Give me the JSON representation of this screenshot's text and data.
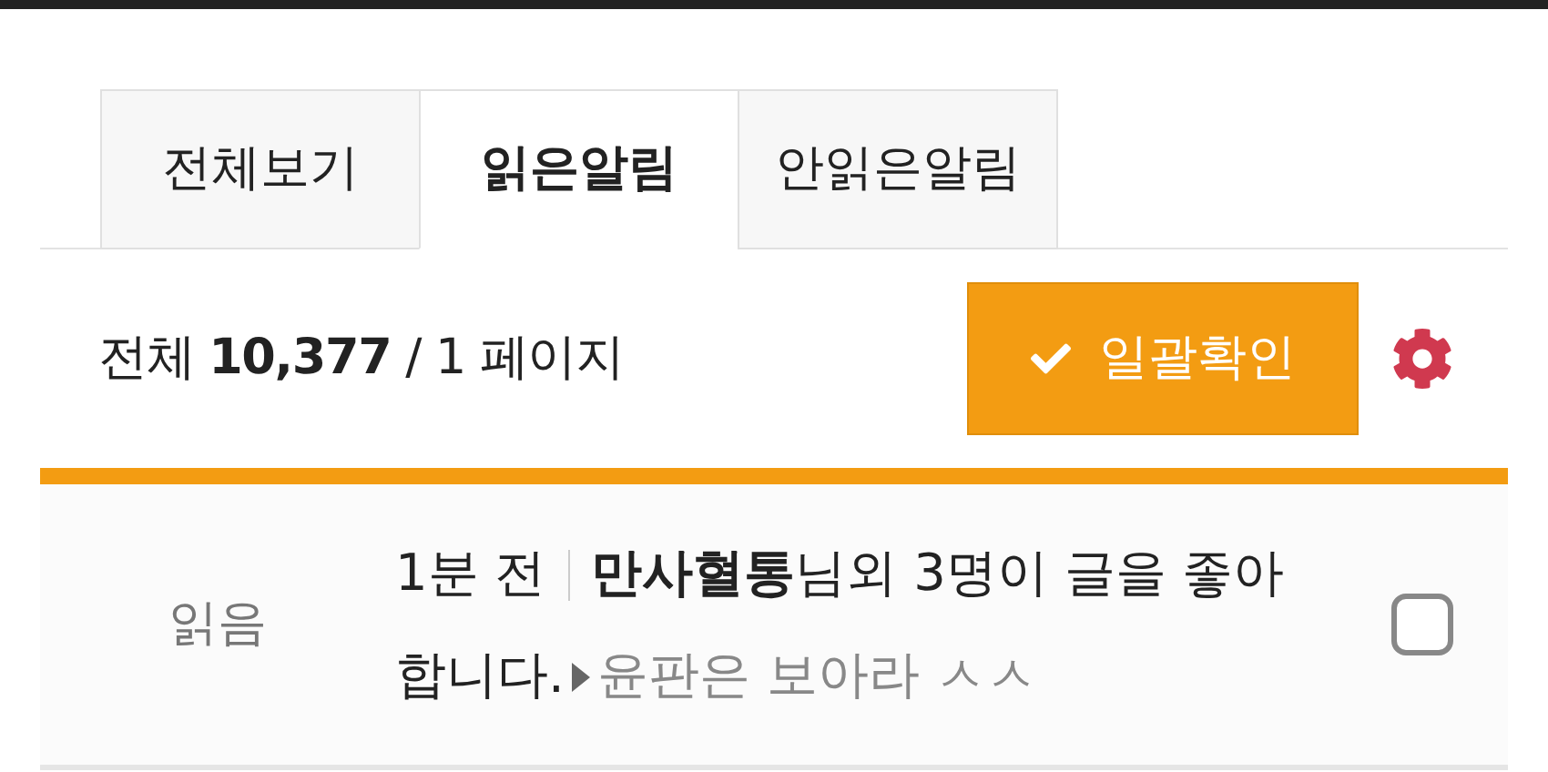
{
  "tabs": [
    {
      "label": "전체보기",
      "selected": false
    },
    {
      "label": "읽은알림",
      "selected": true
    },
    {
      "label": "안읽은알림",
      "selected": false
    }
  ],
  "summary": {
    "text": "전체 **10,377** / 1 페이지",
    "button": "일괄확인"
  },
  "notifications": [
    {
      "status": "읽음",
      "time": "1분 전",
      "message": "**만사혈통**님외 3명이 글을 좋아 합니다.",
      "post": "윤판은 보아라 ㅅㅅ",
      "checked": false
    }
  ]
}
